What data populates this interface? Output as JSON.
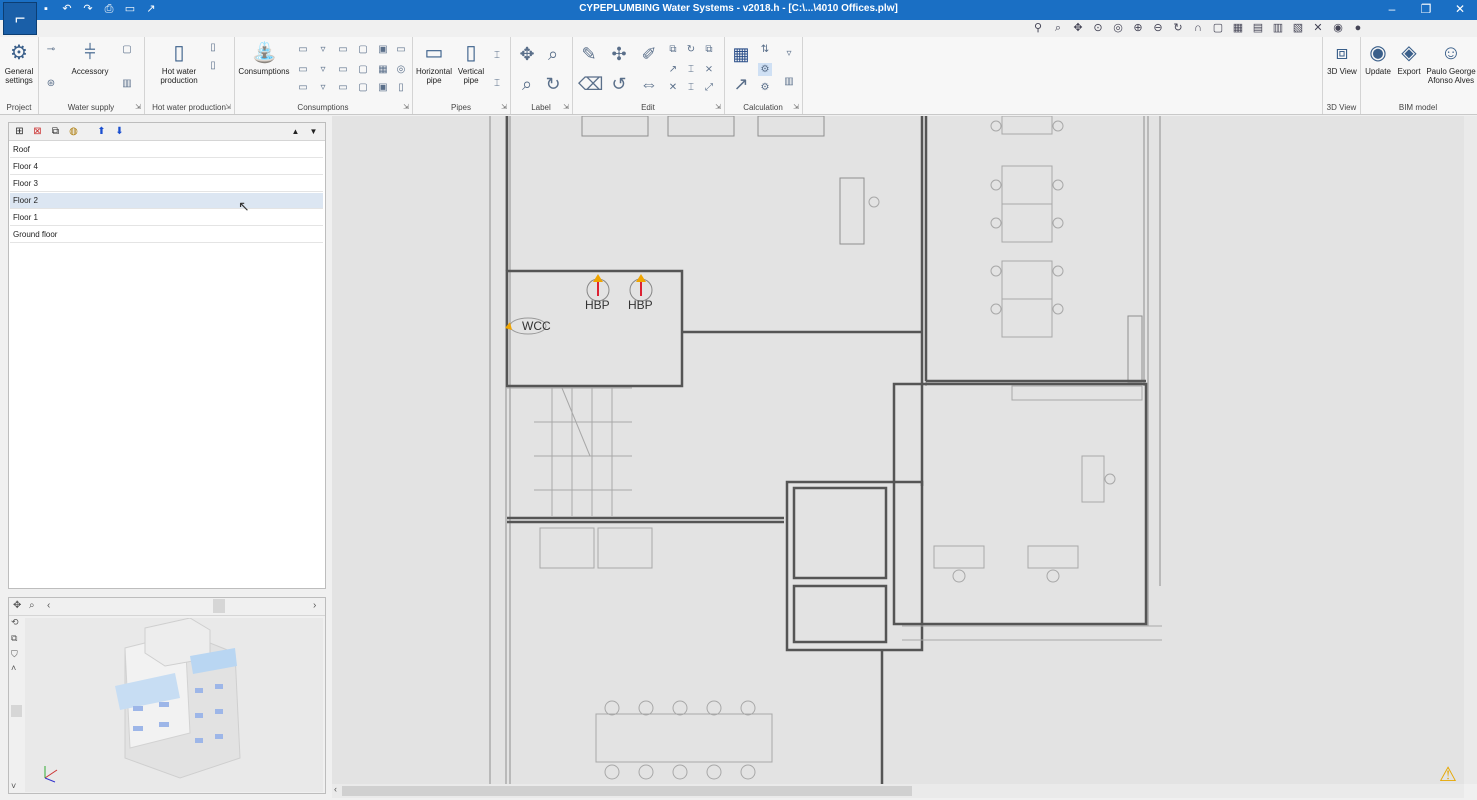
{
  "window": {
    "title": "CYPEPLUMBING Water Systems - v2018.h - [C:\\...\\4010 Offices.plw]"
  },
  "quick_access": [
    "save-icon",
    "undo-icon",
    "redo-icon",
    "print-icon",
    "print-preview-icon",
    "export-icon"
  ],
  "window_controls": {
    "minimize": "–",
    "restore": "❐",
    "close": "✕"
  },
  "ribbon": {
    "groups": {
      "project": "Project",
      "water_supply": "Water supply",
      "hot_water_production": "Hot water production",
      "consumptions": "Consumptions",
      "pipes": "Pipes",
      "label": "Label",
      "edit": "Edit",
      "calculation": "Calculation",
      "view3d": "3D View",
      "bim_model": "BIM model"
    },
    "buttons": {
      "general_settings": "General settings",
      "accessory": "Accessory",
      "hot_water_production": "Hot water production",
      "consumptions": "Consumptions",
      "horizontal_pipe": "Horizontal pipe",
      "vertical_pipe": "Vertical pipe",
      "view3d": "3D View",
      "update": "Update",
      "export": "Export",
      "user": "Paulo George Afonso Alves"
    }
  },
  "floors": {
    "items": [
      "Roof",
      "Floor 4",
      "Floor 3",
      "Floor 2",
      "Floor 1",
      "Ground floor"
    ],
    "selected": "Floor 2"
  },
  "drawing": {
    "labels": {
      "wcc": "WCC",
      "hbp1": "HBP",
      "hbp2": "HBP"
    }
  },
  "colors": {
    "title_bar": "#1a6fc4",
    "selection": "#dce6f2",
    "canvas_bg": "#e3e3e3",
    "warning": "#e6a700"
  }
}
